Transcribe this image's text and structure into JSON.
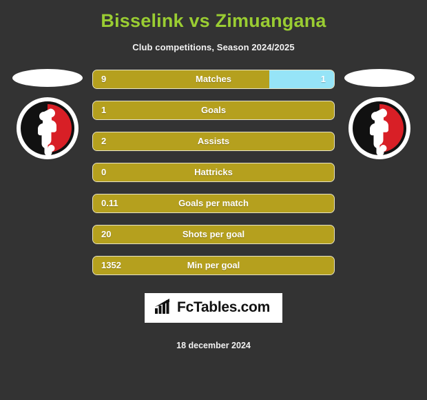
{
  "header": {
    "title": "Bisselink vs Zimuangana",
    "subtitle": "Club competitions, Season 2024/2025",
    "title_color": "#9ACD32"
  },
  "players": {
    "left": {
      "photo_alt": "player-photo-placeholder",
      "crest_alt": "club-crest"
    },
    "right": {
      "photo_alt": "player-photo-placeholder",
      "crest_alt": "club-crest"
    }
  },
  "footer": {
    "logo_text": "FcTables.com",
    "logo_icon": "bar-chart-icon",
    "date": "18 december 2024"
  },
  "colors": {
    "background": "#333333",
    "bar_left": "#B5A01E",
    "bar_right": "#96E4F7",
    "bar_border": "#e8e4c8",
    "text": "#ffffff"
  },
  "chart_data": {
    "type": "bar",
    "title": "Bisselink vs Zimuangana",
    "subtitle": "Club competitions, Season 2024/2025",
    "orientation": "horizontal",
    "style": "diverging-comparison",
    "legend_position": "none",
    "grid": false,
    "series": [
      {
        "name": "Bisselink",
        "side": "left",
        "color": "#B5A01E"
      },
      {
        "name": "Zimuangana",
        "side": "right",
        "color": "#96E4F7"
      }
    ],
    "categories": [
      "Matches",
      "Goals",
      "Assists",
      "Hattricks",
      "Goals per match",
      "Shots per goal",
      "Min per goal"
    ],
    "rows": [
      {
        "label": "Matches",
        "left_value": "9",
        "right_value": "1",
        "left_pct": 73,
        "right_pct": 27
      },
      {
        "label": "Goals",
        "left_value": "1",
        "right_value": "",
        "left_pct": 100,
        "right_pct": 0
      },
      {
        "label": "Assists",
        "left_value": "2",
        "right_value": "",
        "left_pct": 100,
        "right_pct": 0
      },
      {
        "label": "Hattricks",
        "left_value": "0",
        "right_value": "",
        "left_pct": 100,
        "right_pct": 0
      },
      {
        "label": "Goals per match",
        "left_value": "0.11",
        "right_value": "",
        "left_pct": 100,
        "right_pct": 0
      },
      {
        "label": "Shots per goal",
        "left_value": "20",
        "right_value": "",
        "left_pct": 100,
        "right_pct": 0
      },
      {
        "label": "Min per goal",
        "left_value": "1352",
        "right_value": "",
        "left_pct": 100,
        "right_pct": 0
      }
    ],
    "left_values": [
      "9",
      "1",
      "2",
      "0",
      "0.11",
      "20",
      "1352"
    ],
    "right_values": [
      "1",
      "",
      "",
      "",
      "",
      "",
      ""
    ]
  }
}
